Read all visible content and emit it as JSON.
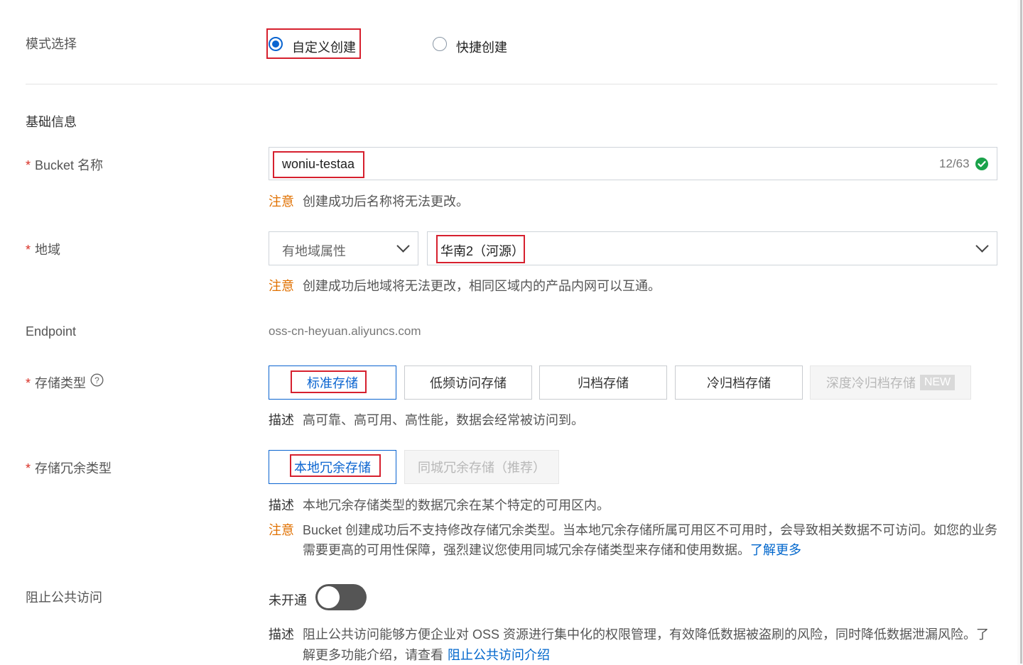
{
  "mode": {
    "label": "模式选择",
    "option_custom": "自定义创建",
    "option_quick": "快捷创建"
  },
  "basic": {
    "title": "基础信息"
  },
  "bucket": {
    "required": "*",
    "label": "Bucket 名称",
    "value": "woniu-testaa",
    "count": "12/63",
    "note_key": "注意",
    "note_text": "创建成功后名称将无法更改。"
  },
  "region": {
    "required": "*",
    "label": "地域",
    "attr_select": "有地域属性",
    "region_select": "华南2（河源）",
    "note_key": "注意",
    "note_text": "创建成功后地域将无法更改，相同区域内的产品内网可以互通。"
  },
  "endpoint": {
    "label": "Endpoint",
    "value": "oss-cn-heyuan.aliyuncs.com"
  },
  "storage": {
    "required": "*",
    "label": "存储类型",
    "options": [
      "标准存储",
      "低频访问存储",
      "归档存储",
      "冷归档存储",
      "深度冷归档存储"
    ],
    "new_badge": "NEW",
    "desc_key": "描述",
    "desc_text": "高可靠、高可用、高性能，数据会经常被访问到。"
  },
  "redundancy": {
    "required": "*",
    "label": "存储冗余类型",
    "options": [
      "本地冗余存储",
      "同城冗余存储（推荐）"
    ],
    "desc_key": "描述",
    "desc_text": "本地冗余存储类型的数据冗余在某个特定的可用区内。",
    "note_key": "注意",
    "note_line1": "Bucket 创建成功后不支持修改存储冗余类型。当本地冗余存储所属可用区不可用时，会导致相关数据不可访问。如您的业务",
    "note_line2": "需要更高的可用性保障，强烈建议您使用同城冗余存储类型来存储和使用数据。",
    "note_link": "了解更多"
  },
  "public_access": {
    "label": "阻止公共访问",
    "toggle_state": "未开通",
    "desc_key": "描述",
    "desc_line1": "阻止公共访问能够方便企业对 OSS 资源进行集中化的权限管理，有效降低数据被盗刷的风险，同时降低数据泄漏风险。了",
    "desc_line2": "解更多功能介绍，请查看",
    "desc_link": "阻止公共访问介绍"
  },
  "colors": {
    "primary": "#0a64d0",
    "warning": "#e07000",
    "required": "#d93026",
    "highlight_box": "#d6202e",
    "success": "#1aa24a",
    "toggle_off": "#555555"
  }
}
